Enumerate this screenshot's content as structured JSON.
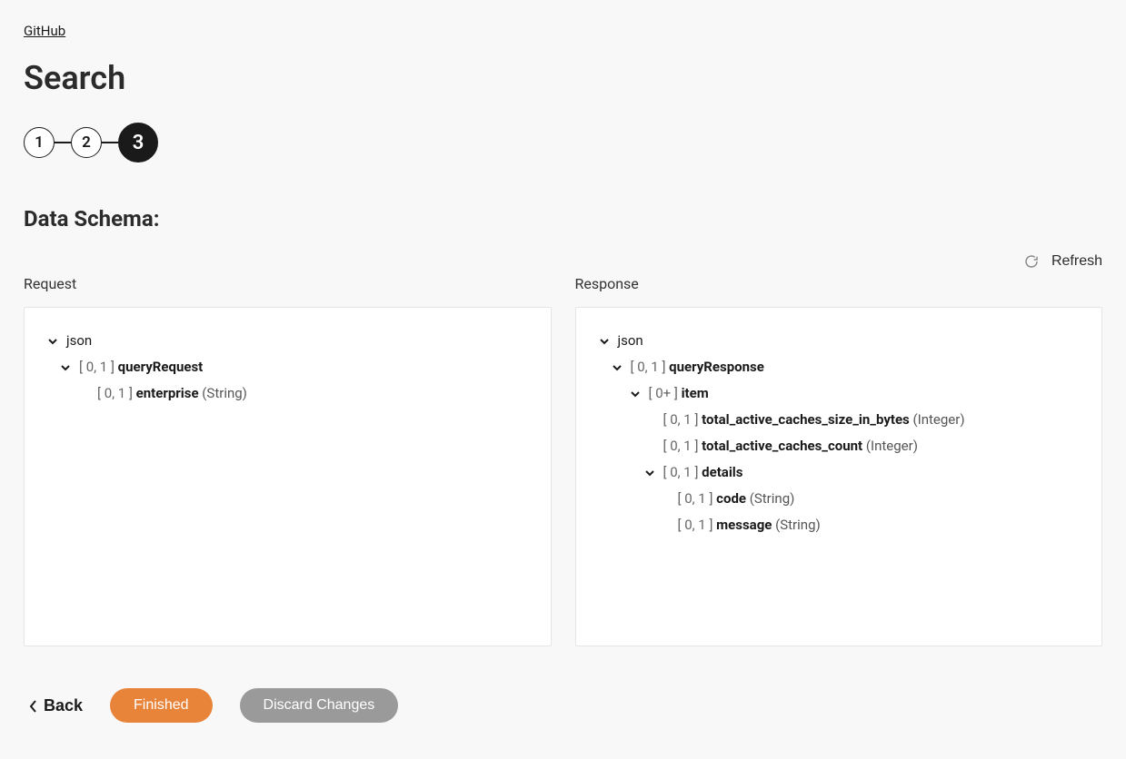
{
  "breadcrumb": "GitHub",
  "title": "Search",
  "steps": [
    "1",
    "2",
    "3"
  ],
  "active_step": 2,
  "section_title": "Data Schema:",
  "refresh_label": "Refresh",
  "request_label": "Request",
  "response_label": "Response",
  "request_tree": {
    "root": "json",
    "items": [
      {
        "card": "[ 0, 1 ]",
        "name": "queryRequest",
        "type": "",
        "expandable": true,
        "indent": 1
      },
      {
        "card": "[ 0, 1 ]",
        "name": "enterprise",
        "type": "(String)",
        "expandable": false,
        "indent": 2
      }
    ]
  },
  "response_tree": {
    "root": "json",
    "items": [
      {
        "card": "[ 0, 1 ]",
        "name": "queryResponse",
        "type": "",
        "expandable": true,
        "indent": 1
      },
      {
        "card": "[ 0+ ]",
        "name": "item",
        "type": "",
        "expandable": true,
        "indent": 2
      },
      {
        "card": "[ 0, 1 ]",
        "name": "total_active_caches_size_in_bytes",
        "type": "(Integer)",
        "expandable": false,
        "indent": 3
      },
      {
        "card": "[ 0, 1 ]",
        "name": "total_active_caches_count",
        "type": "(Integer)",
        "expandable": false,
        "indent": 3
      },
      {
        "card": "[ 0, 1 ]",
        "name": "details",
        "type": "",
        "expandable": true,
        "indent": 3
      },
      {
        "card": "[ 0, 1 ]",
        "name": "code",
        "type": "(String)",
        "expandable": false,
        "indent": 4
      },
      {
        "card": "[ 0, 1 ]",
        "name": "message",
        "type": "(String)",
        "expandable": false,
        "indent": 4
      }
    ]
  },
  "buttons": {
    "back": "Back",
    "finished": "Finished",
    "discard": "Discard Changes"
  }
}
